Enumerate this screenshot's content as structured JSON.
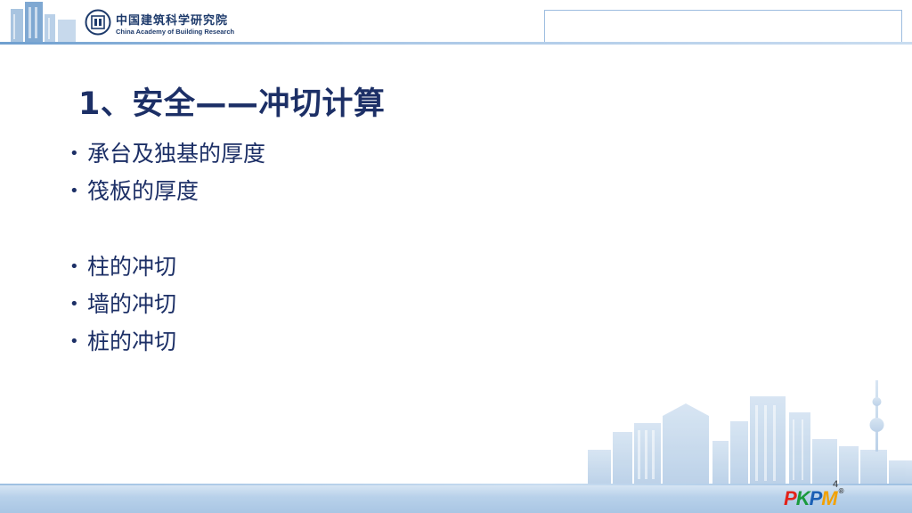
{
  "header": {
    "org_name_cn": "中国建筑科学研究院",
    "org_name_en": "China Academy of Building Research"
  },
  "slide": {
    "title": "1、安全——冲切计算",
    "bullets": [
      "承台及独基的厚度",
      "筏板的厚度",
      "",
      "柱的冲切",
      "墙的冲切",
      "桩的冲切"
    ],
    "bullet_marker": "•",
    "page_number": "4"
  },
  "footer": {
    "logo_letters": [
      "P",
      "K",
      "P",
      "M"
    ],
    "logo_reg": "®"
  },
  "colors": {
    "title": "#1c2f66",
    "header_rule": "#6f9fcf",
    "footer_band": "#a9c6e4",
    "logo_p": "#e2231a",
    "logo_k": "#1a9a3c",
    "logo_p2": "#1a5fb4",
    "logo_m": "#f2a100"
  },
  "icons": {
    "header_left": "building-silhouette-icon",
    "org_emblem": "cabr-emblem-icon",
    "skyline": "city-skyline-icon"
  }
}
